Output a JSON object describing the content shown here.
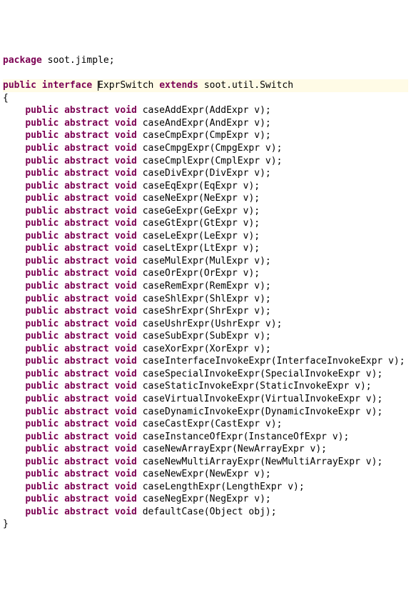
{
  "package_kw": "package",
  "package_name": "soot.jimple",
  "decl": {
    "public": "public",
    "interface": "interface",
    "name": "ExprSwitch",
    "extends": "extends",
    "super": "soot.util.Switch"
  },
  "method_prefix": {
    "public": "public",
    "abstract": "abstract",
    "void": "void"
  },
  "methods": [
    {
      "name": "caseAddExpr",
      "ptype": "AddExpr",
      "pname": "v"
    },
    {
      "name": "caseAndExpr",
      "ptype": "AndExpr",
      "pname": "v"
    },
    {
      "name": "caseCmpExpr",
      "ptype": "CmpExpr",
      "pname": "v"
    },
    {
      "name": "caseCmpgExpr",
      "ptype": "CmpgExpr",
      "pname": "v"
    },
    {
      "name": "caseCmplExpr",
      "ptype": "CmplExpr",
      "pname": "v"
    },
    {
      "name": "caseDivExpr",
      "ptype": "DivExpr",
      "pname": "v"
    },
    {
      "name": "caseEqExpr",
      "ptype": "EqExpr",
      "pname": "v"
    },
    {
      "name": "caseNeExpr",
      "ptype": "NeExpr",
      "pname": "v"
    },
    {
      "name": "caseGeExpr",
      "ptype": "GeExpr",
      "pname": "v"
    },
    {
      "name": "caseGtExpr",
      "ptype": "GtExpr",
      "pname": "v"
    },
    {
      "name": "caseLeExpr",
      "ptype": "LeExpr",
      "pname": "v"
    },
    {
      "name": "caseLtExpr",
      "ptype": "LtExpr",
      "pname": "v"
    },
    {
      "name": "caseMulExpr",
      "ptype": "MulExpr",
      "pname": "v"
    },
    {
      "name": "caseOrExpr",
      "ptype": "OrExpr",
      "pname": "v"
    },
    {
      "name": "caseRemExpr",
      "ptype": "RemExpr",
      "pname": "v"
    },
    {
      "name": "caseShlExpr",
      "ptype": "ShlExpr",
      "pname": "v"
    },
    {
      "name": "caseShrExpr",
      "ptype": "ShrExpr",
      "pname": "v"
    },
    {
      "name": "caseUshrExpr",
      "ptype": "UshrExpr",
      "pname": "v"
    },
    {
      "name": "caseSubExpr",
      "ptype": "SubExpr",
      "pname": "v"
    },
    {
      "name": "caseXorExpr",
      "ptype": "XorExpr",
      "pname": "v"
    },
    {
      "name": "caseInterfaceInvokeExpr",
      "ptype": "InterfaceInvokeExpr",
      "pname": "v"
    },
    {
      "name": "caseSpecialInvokeExpr",
      "ptype": "SpecialInvokeExpr",
      "pname": "v"
    },
    {
      "name": "caseStaticInvokeExpr",
      "ptype": "StaticInvokeExpr",
      "pname": "v"
    },
    {
      "name": "caseVirtualInvokeExpr",
      "ptype": "VirtualInvokeExpr",
      "pname": "v"
    },
    {
      "name": "caseDynamicInvokeExpr",
      "ptype": "DynamicInvokeExpr",
      "pname": "v"
    },
    {
      "name": "caseCastExpr",
      "ptype": "CastExpr",
      "pname": "v"
    },
    {
      "name": "caseInstanceOfExpr",
      "ptype": "InstanceOfExpr",
      "pname": "v"
    },
    {
      "name": "caseNewArrayExpr",
      "ptype": "NewArrayExpr",
      "pname": "v"
    },
    {
      "name": "caseNewMultiArrayExpr",
      "ptype": "NewMultiArrayExpr",
      "pname": "v"
    },
    {
      "name": "caseNewExpr",
      "ptype": "NewExpr",
      "pname": "v"
    },
    {
      "name": "caseLengthExpr",
      "ptype": "LengthExpr",
      "pname": "v"
    },
    {
      "name": "caseNegExpr",
      "ptype": "NegExpr",
      "pname": "v"
    },
    {
      "name": "defaultCase",
      "ptype": "Object",
      "pname": "obj"
    }
  ],
  "braces": {
    "open": "{",
    "close": "}"
  },
  "semicolon": ";"
}
